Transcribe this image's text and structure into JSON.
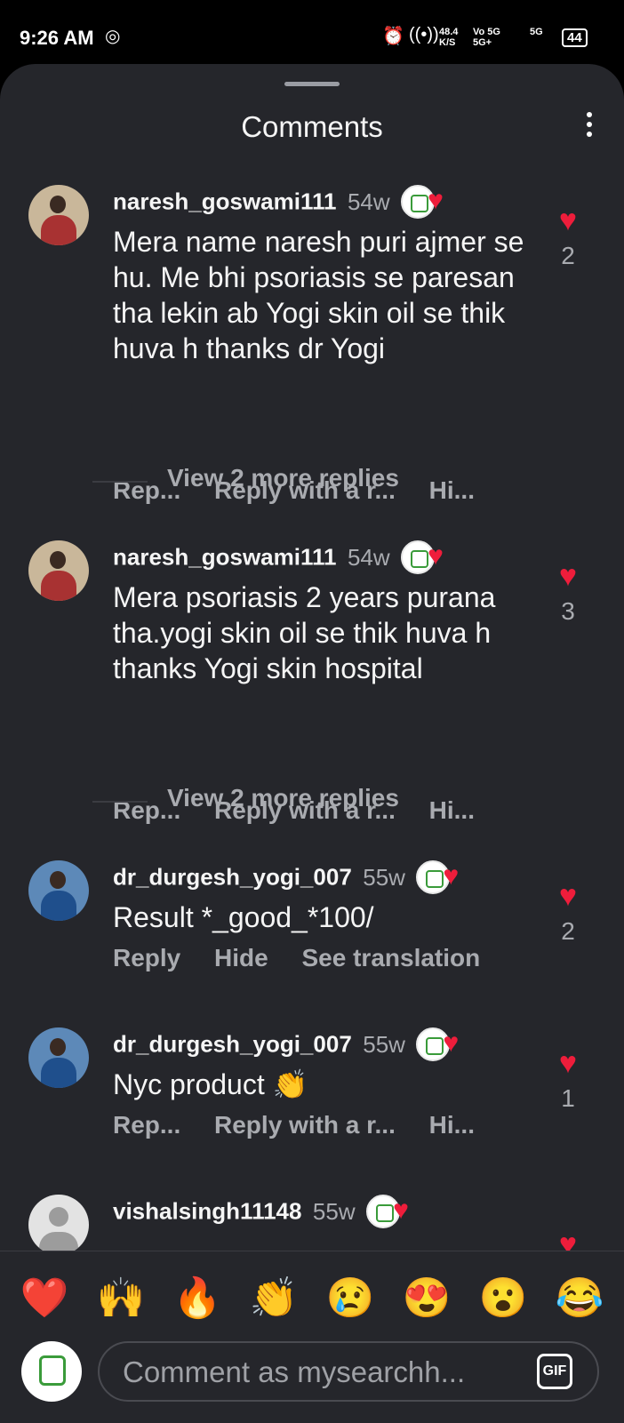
{
  "status_bar": {
    "time": "9:26 AM",
    "network_speed": "48.4 K/S",
    "network_1": "Vo 5G 5G+",
    "network_2": "5G",
    "battery": "44"
  },
  "sheet": {
    "title": "Comments"
  },
  "comments": [
    {
      "username": "naresh_goswami111",
      "age": "54w",
      "text": "Mera name naresh puri ajmer se hu. Me bhi psoriasis se paresan tha lekin ab Yogi skin oil se thik huva h thanks dr Yogi",
      "actions": [
        "Rep...",
        "Reply with a r...",
        "Hi..."
      ],
      "likes": "2",
      "view_replies": "View 2 more replies"
    },
    {
      "username": "naresh_goswami111",
      "age": "54w",
      "text": "Mera psoriasis 2 years purana tha.yogi skin oil se thik huva h thanks Yogi skin hospital",
      "actions": [
        "Rep...",
        "Reply with a r...",
        "Hi..."
      ],
      "likes": "3",
      "view_replies": "View 2 more replies"
    },
    {
      "username": "dr_durgesh_yogi_007",
      "age": "55w",
      "text": "Result *_good_*100/",
      "actions": [
        "Reply",
        "Hide",
        "See translation"
      ],
      "likes": "2"
    },
    {
      "username": "dr_durgesh_yogi_007",
      "age": "55w",
      "text": "Nyc product 👏",
      "actions": [
        "Rep...",
        "Reply with a r...",
        "Hi..."
      ],
      "likes": "1"
    },
    {
      "username": "vishalsingh11148",
      "age": "55w"
    }
  ],
  "emoji_bar": [
    "❤️",
    "🙌",
    "🔥",
    "👏",
    "😢",
    "😍",
    "😮",
    "😂"
  ],
  "composer": {
    "placeholder": "Comment as mysearchh...",
    "gif_label": "GIF"
  }
}
